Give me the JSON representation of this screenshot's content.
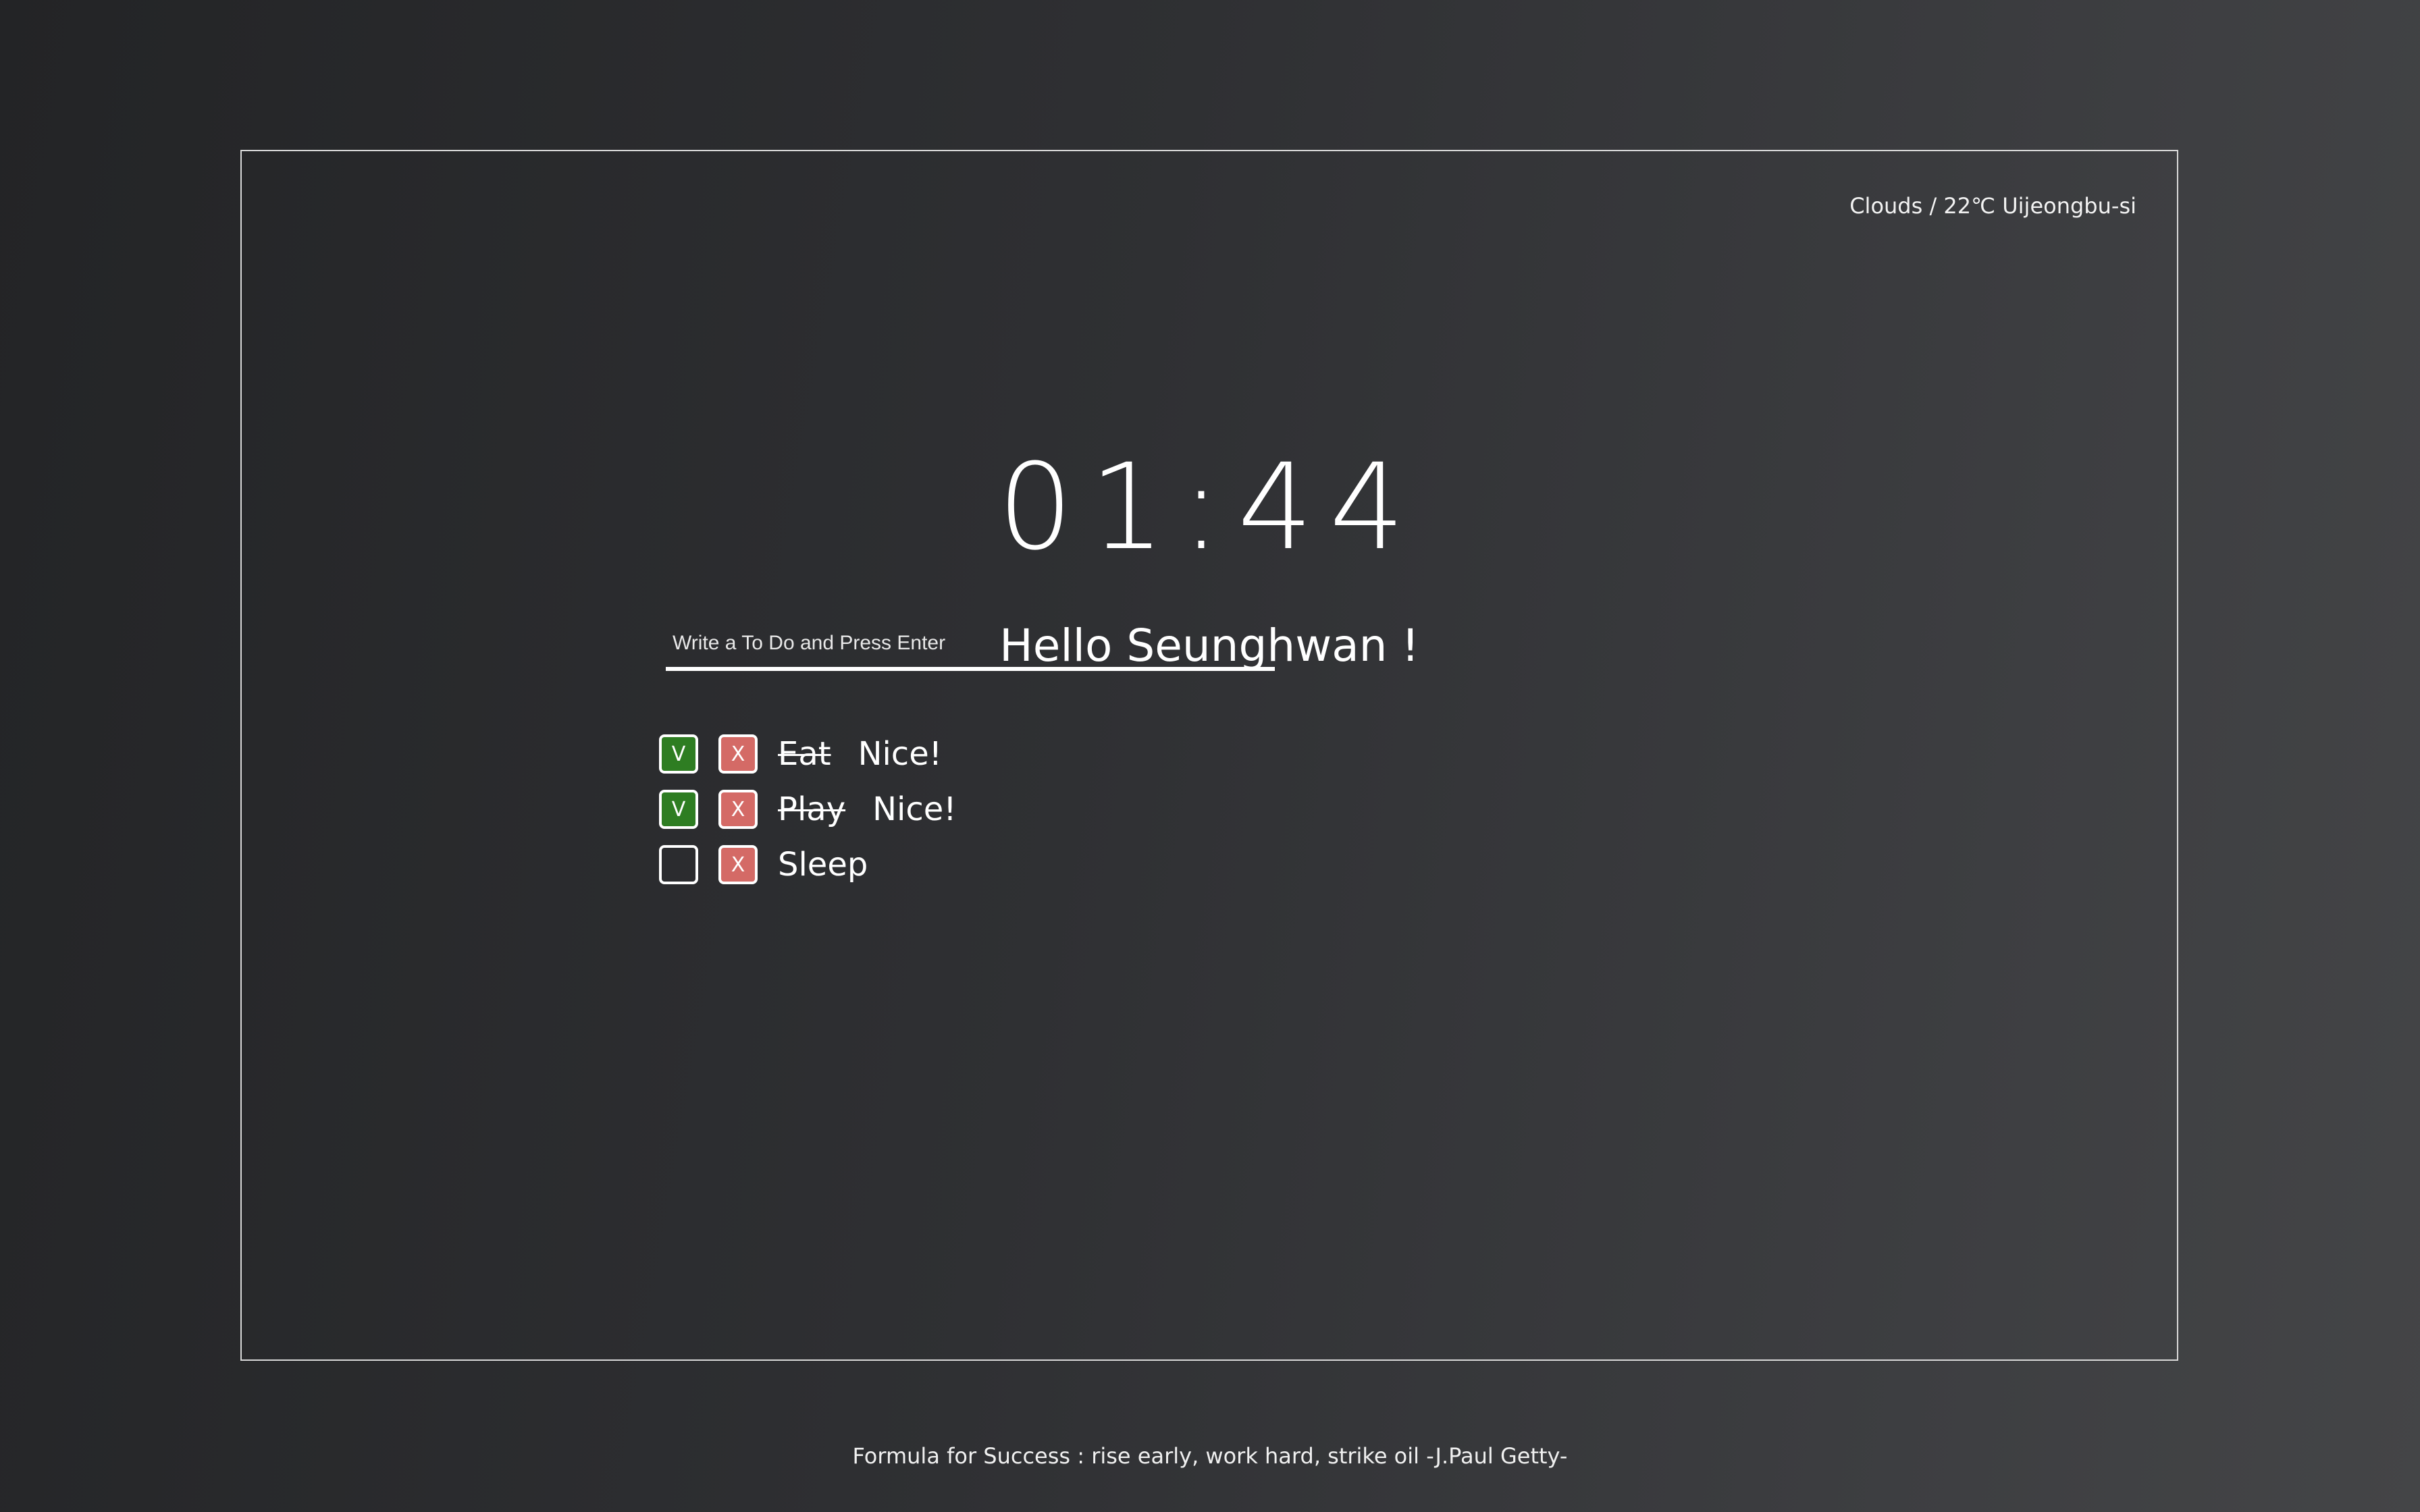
{
  "weather": {
    "text": "Clouds / 22℃ Uijeongbu-si"
  },
  "clock": {
    "time": "01:44"
  },
  "greeting": {
    "text": "Hello Seunghwan !"
  },
  "todo_input": {
    "placeholder": "Write a To Do and Press Enter",
    "value": ""
  },
  "todos": [
    {
      "check_label": "V",
      "delete_label": "X",
      "text": "Eat",
      "done": true,
      "note": "Nice!"
    },
    {
      "check_label": "V",
      "delete_label": "X",
      "text": "Play",
      "done": true,
      "note": "Nice!"
    },
    {
      "check_label": "",
      "delete_label": "X",
      "text": "Sleep",
      "done": false,
      "note": ""
    }
  ],
  "quote": {
    "text": "Formula for Success : rise early, work hard, strike oil -J.Paul Getty-"
  },
  "colors": {
    "done_check": "#2e7d22",
    "delete": "#d46a66",
    "frame_border": "#d9d9d9"
  }
}
